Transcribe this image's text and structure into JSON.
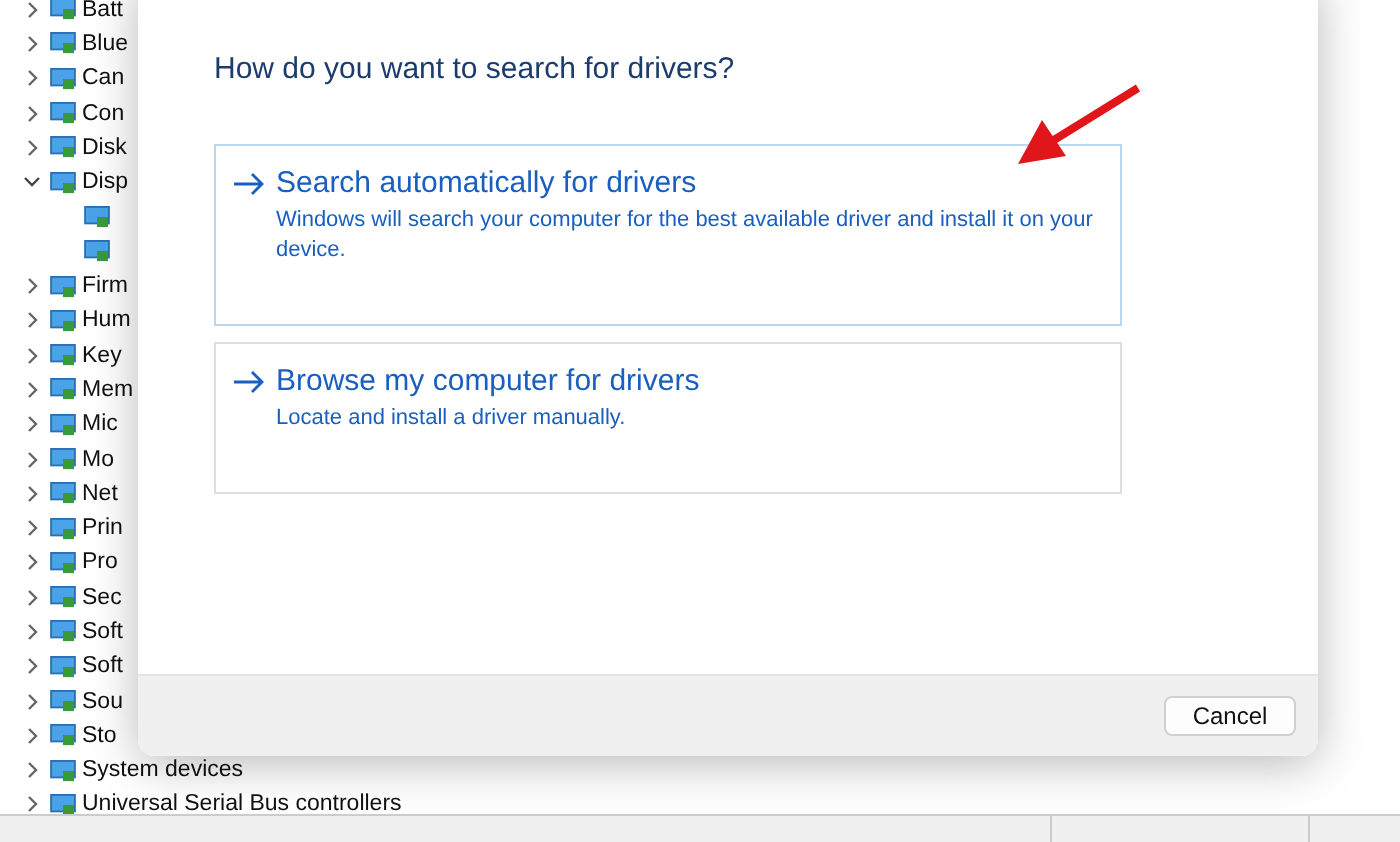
{
  "device_tree": [
    {
      "label": "Batt",
      "expanded": false
    },
    {
      "label": "Blue",
      "expanded": false
    },
    {
      "label": "Can",
      "expanded": false
    },
    {
      "label": "Con",
      "expanded": false
    },
    {
      "label": "Disk",
      "expanded": false
    },
    {
      "label": "Disp",
      "expanded": true,
      "children": [
        {
          "kind": "adapter"
        },
        {
          "kind": "adapter"
        }
      ]
    },
    {
      "label": "Firm",
      "expanded": false
    },
    {
      "label": "Hum",
      "expanded": false
    },
    {
      "label": "Key",
      "expanded": false
    },
    {
      "label": "Mem",
      "expanded": false
    },
    {
      "label": "Mic",
      "expanded": false
    },
    {
      "label": "Mo",
      "expanded": false
    },
    {
      "label": "Net",
      "expanded": false
    },
    {
      "label": "Prin",
      "expanded": false
    },
    {
      "label": "Pro",
      "expanded": false
    },
    {
      "label": "Sec",
      "expanded": false
    },
    {
      "label": "Soft",
      "expanded": false
    },
    {
      "label": "Soft",
      "expanded": false
    },
    {
      "label": "Sou",
      "expanded": false
    },
    {
      "label": "Sto",
      "expanded": false
    },
    {
      "label": "System devices",
      "expanded": false
    },
    {
      "label": "Universal Serial Bus controllers",
      "expanded": false
    }
  ],
  "dialog": {
    "heading": "How do you want to search for drivers?",
    "options": [
      {
        "title": "Search automatically for drivers",
        "description": "Windows will search your computer for the best available driver and install it on your device.",
        "selected": true
      },
      {
        "title": "Browse my computer for drivers",
        "description": "Locate and install a driver manually.",
        "selected": false
      }
    ],
    "buttons": [
      "Cancel"
    ]
  }
}
